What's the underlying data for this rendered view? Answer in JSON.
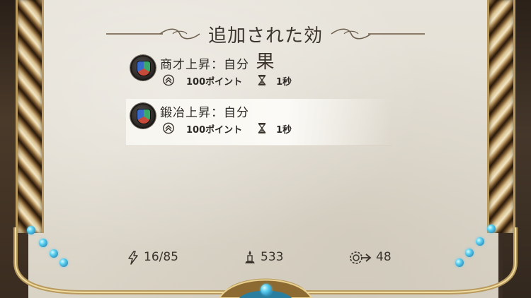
{
  "panel": {
    "title": "追加された効果"
  },
  "effects": [
    {
      "name": "商才上昇：自分",
      "icon": "shield-emblem-icon",
      "points": "100ポイント",
      "duration": "1秒",
      "highlighted": false
    },
    {
      "name": "鍛冶上昇：自分",
      "icon": "shield-emblem-icon",
      "points": "100ポイント",
      "duration": "1秒",
      "highlighted": true
    }
  ],
  "stats": {
    "energy": "16/85",
    "gold": "533",
    "speed": "48"
  },
  "colors": {
    "parchment": "#e2ddd2",
    "text": "#3a342d",
    "gold": "#c8a45a",
    "gem": "#5ad0f0"
  }
}
